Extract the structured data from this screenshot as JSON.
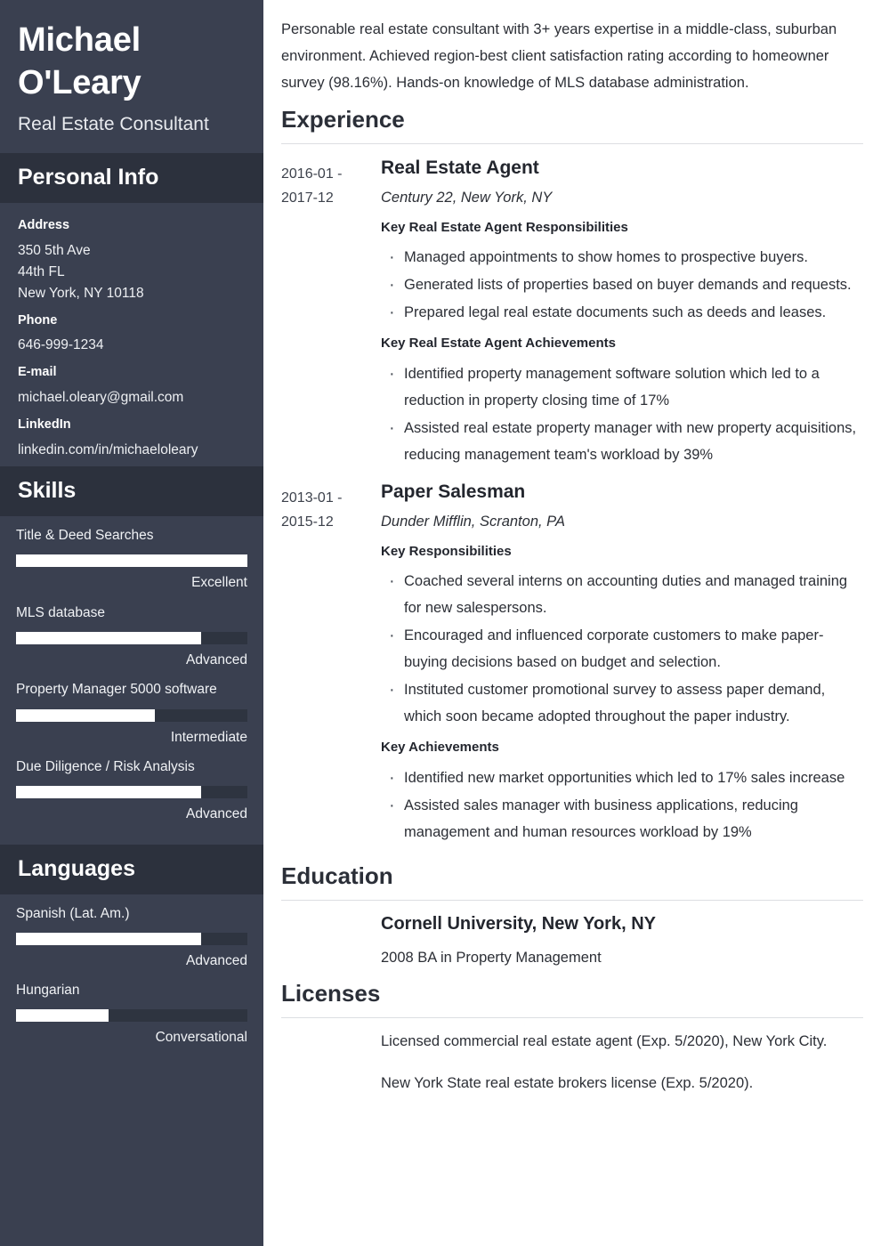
{
  "theme": {
    "sidebar_bg": "#3a4050",
    "sidebar_header_bg": "#2c313d",
    "bar_track": "#2e3440",
    "bar_fill": "#ffffff",
    "text_dark": "#2c2f36",
    "rule": "#dcdee2"
  },
  "sidebar": {
    "name": "Michael O'Leary",
    "job_title": "Real Estate Consultant",
    "personal_info": {
      "heading": "Personal Info",
      "fields": [
        {
          "label": "Address",
          "lines": [
            "350 5th Ave",
            "44th FL",
            "New York, NY 10118"
          ]
        },
        {
          "label": "Phone",
          "lines": [
            "646-999-1234"
          ]
        },
        {
          "label": "E-mail",
          "lines": [
            "michael.oleary@gmail.com"
          ]
        },
        {
          "label": "LinkedIn",
          "lines": [
            "linkedin.com/in/michaeloleary"
          ]
        }
      ]
    },
    "skills": {
      "heading": "Skills",
      "items": [
        {
          "name": "Title & Deed Searches",
          "level": "Excellent",
          "percent": 100
        },
        {
          "name": "MLS database",
          "level": "Advanced",
          "percent": 80
        },
        {
          "name": "Property Manager 5000 software",
          "level": "Intermediate",
          "percent": 60
        },
        {
          "name": "Due Diligence / Risk Analysis",
          "level": "Advanced",
          "percent": 80
        }
      ]
    },
    "languages": {
      "heading": "Languages",
      "items": [
        {
          "name": "Spanish (Lat. Am.)",
          "level": "Advanced",
          "percent": 80
        },
        {
          "name": "Hungarian",
          "level": "Conversational",
          "percent": 40
        }
      ]
    }
  },
  "main": {
    "summary": "Personable real estate consultant with 3+ years expertise in a middle-class, suburban environment. Achieved region-best client satisfaction rating according to homeowner survey (98.16%). Hands-on knowledge of MLS database administration.",
    "experience": {
      "heading": "Experience",
      "entries": [
        {
          "date_start": "2016-01 -",
          "date_end": "2017-12",
          "role": "Real Estate Agent",
          "company": "Century 22, New York, NY",
          "groups": [
            {
              "heading": "Key Real Estate Agent Responsibilities",
              "bullets": [
                "Managed appointments to show homes to prospective buyers.",
                "Generated lists of properties based on buyer demands and requests.",
                "Prepared legal real estate documents such as deeds and leases."
              ]
            },
            {
              "heading": "Key Real Estate Agent Achievements",
              "bullets": [
                "Identified property management software solution which led to a reduction in property closing time of 17%",
                "Assisted real estate property manager with new property acquisitions, reducing management team's workload by 39%"
              ]
            }
          ]
        },
        {
          "date_start": "2013-01 -",
          "date_end": "2015-12",
          "role": "Paper Salesman",
          "company": "Dunder Mifflin, Scranton, PA",
          "groups": [
            {
              "heading": "Key Responsibilities",
              "bullets": [
                "Coached several interns on accounting duties and managed training for new salespersons.",
                "Encouraged and influenced corporate customers to make paper-buying decisions based on budget and selection.",
                "Instituted customer promotional survey to assess paper demand, which soon became adopted throughout the paper industry."
              ]
            },
            {
              "heading": "Key Achievements",
              "bullets": [
                "Identified new market opportunities which led to 17% sales increase",
                "Assisted sales manager with business applications, reducing management and human resources workload by 19%"
              ]
            }
          ]
        }
      ]
    },
    "education": {
      "heading": "Education",
      "entries": [
        {
          "school": "Cornell University, New York, NY",
          "degree": "2008 BA in Property Management"
        }
      ]
    },
    "licenses": {
      "heading": "Licenses",
      "items": [
        "Licensed commercial real estate agent (Exp. 5/2020), New York City.",
        "New York State real estate brokers license (Exp. 5/2020)."
      ]
    }
  }
}
